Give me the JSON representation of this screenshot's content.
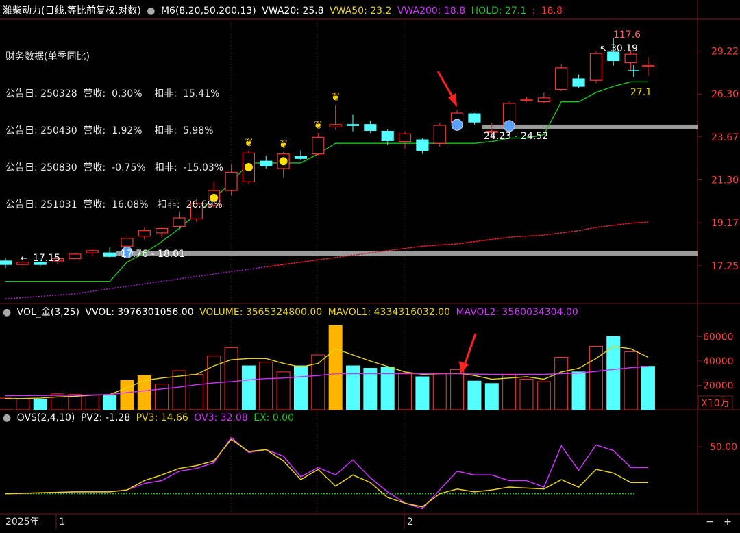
{
  "header": {
    "title": "潍柴动力(日线.等比前复权.对数)",
    "indicator": "M6(8,20,50,200,13)",
    "vwa20": "VWA20: 25.8",
    "vwa50": "VWA50: 23.2",
    "vwa200": "VWA200: 18.8",
    "hold_label": "HOLD: 27.1",
    "hold_colon": ":",
    "hold_value": "18.8"
  },
  "finance": {
    "title": "财务数据(单季同比)",
    "rows": [
      "公告日: 250328  营收:  0.30%    扣非:  15.41%",
      "公告日: 250430  营收:  1.92%    扣非:  5.98%",
      "公告日: 250830  营收:  -0.75%   扣非:  -15.03%",
      "公告日: 251031  营收:  16.08%   扣非:  26.69%"
    ]
  },
  "vol_header": {
    "name": "VOL_金(3,25)",
    "vvol": "VVOL: 3976301056.00",
    "volume": "VOLUME: 3565324800.00",
    "mavol1": "MAVOL1: 4334316032.00",
    "mavol2": "MAVOL2: 3560034304.00"
  },
  "ovs_header": {
    "name": "OVS(2,4,10)",
    "pv2": "PV2: -1.28",
    "pv3": "PV3: 14.66",
    "ov3": "OV3: 32.08",
    "ex": "EX: 0.00"
  },
  "time_axis": {
    "year": "2025年",
    "labels": [
      {
        "text": "1",
        "idx": 0
      },
      {
        "text": "2",
        "idx": 20
      }
    ]
  },
  "annotations": {
    "high": "117.6",
    "high_price": "30.19",
    "low_price": "17.15",
    "range_low": "17.76 - 18.01",
    "range_high": "24.23 - 24.52",
    "hold_price": "27.1",
    "vol_unit": "X10万"
  },
  "colors": {
    "up": "#ff3232",
    "down": "#54ffff",
    "vwa20": "#ffffff",
    "vwa50": "#e8d21d",
    "vwa200": "#d033ff",
    "hold": "#1ec31e",
    "ma200": "#e0203a",
    "grid": "#7a1b1b"
  },
  "chart_data": [
    {
      "type": "candlestick",
      "title": "潍柴动力(日线.等比前复权.对数)",
      "scale": "log",
      "yticks": [
        "29.22",
        "26.30",
        "23.67",
        "21.30",
        "19.17",
        "17.25"
      ],
      "ylim": [
        15.8,
        31.5
      ],
      "bars": [
        {
          "o": 17.45,
          "h": 17.6,
          "l": 17.15,
          "c": 17.3
        },
        {
          "o": 17.3,
          "h": 17.5,
          "l": 17.1,
          "c": 17.4
        },
        {
          "o": 17.4,
          "h": 17.55,
          "l": 17.2,
          "c": 17.3
        },
        {
          "o": 17.45,
          "h": 17.6,
          "l": 17.3,
          "c": 17.55
        },
        {
          "o": 17.55,
          "h": 17.8,
          "l": 17.45,
          "c": 17.75
        },
        {
          "o": 17.8,
          "h": 17.95,
          "l": 17.65,
          "c": 17.9
        },
        {
          "o": 17.8,
          "h": 18.05,
          "l": 17.6,
          "c": 17.65
        },
        {
          "o": 18.1,
          "h": 18.7,
          "l": 17.76,
          "c": 18.45
        },
        {
          "o": 18.55,
          "h": 18.95,
          "l": 18.4,
          "c": 18.8
        },
        {
          "o": 18.7,
          "h": 18.95,
          "l": 18.5,
          "c": 18.9
        },
        {
          "o": 19.0,
          "h": 19.7,
          "l": 18.9,
          "c": 19.4
        },
        {
          "o": 19.35,
          "h": 20.3,
          "l": 19.2,
          "c": 20.1
        },
        {
          "o": 20.0,
          "h": 21.2,
          "l": 19.9,
          "c": 20.75
        },
        {
          "o": 20.75,
          "h": 22.1,
          "l": 20.5,
          "c": 21.7
        },
        {
          "o": 21.2,
          "h": 22.9,
          "l": 21.1,
          "c": 22.75
        },
        {
          "o": 22.3,
          "h": 22.6,
          "l": 21.9,
          "c": 22.05
        },
        {
          "o": 21.9,
          "h": 22.8,
          "l": 21.4,
          "c": 22.7
        },
        {
          "o": 22.55,
          "h": 22.9,
          "l": 22.35,
          "c": 22.45
        },
        {
          "o": 22.7,
          "h": 23.9,
          "l": 22.6,
          "c": 23.65
        },
        {
          "o": 24.25,
          "h": 25.6,
          "l": 24.1,
          "c": 24.4
        },
        {
          "o": 24.4,
          "h": 25.0,
          "l": 24.0,
          "c": 24.35
        },
        {
          "o": 24.4,
          "h": 24.65,
          "l": 23.9,
          "c": 24.05
        },
        {
          "o": 24.0,
          "h": 24.1,
          "l": 23.2,
          "c": 23.45
        },
        {
          "o": 23.4,
          "h": 24.0,
          "l": 23.0,
          "c": 23.85
        },
        {
          "o": 23.5,
          "h": 23.6,
          "l": 22.7,
          "c": 22.9
        },
        {
          "o": 23.3,
          "h": 24.5,
          "l": 23.1,
          "c": 24.35
        },
        {
          "o": 24.5,
          "h": 25.3,
          "l": 24.3,
          "c": 25.1
        },
        {
          "o": 25.05,
          "h": 25.1,
          "l": 24.4,
          "c": 24.55
        },
        {
          "o": 24.0,
          "h": 24.5,
          "l": 23.6,
          "c": 24.0
        },
        {
          "o": 24.3,
          "h": 25.8,
          "l": 24.23,
          "c": 25.7
        },
        {
          "o": 25.9,
          "h": 26.1,
          "l": 25.8,
          "c": 25.95
        },
        {
          "o": 25.8,
          "h": 26.4,
          "l": 25.7,
          "c": 26.05
        },
        {
          "o": 26.6,
          "h": 28.3,
          "l": 26.5,
          "c": 28.05
        },
        {
          "o": 27.3,
          "h": 27.6,
          "l": 26.7,
          "c": 26.8
        },
        {
          "o": 27.2,
          "h": 29.2,
          "l": 27.0,
          "c": 29.05
        },
        {
          "o": 29.15,
          "h": 30.19,
          "l": 28.2,
          "c": 28.55
        },
        {
          "o": 28.4,
          "h": 29.3,
          "l": 27.8,
          "c": 29.0
        },
        {
          "o": 28.2,
          "h": 28.8,
          "l": 27.5,
          "c": 28.2
        }
      ],
      "hold": [
        16.6,
        16.6,
        16.6,
        16.6,
        16.6,
        16.6,
        16.6,
        17.4,
        17.8,
        18.3,
        18.9,
        19.6,
        20.35,
        21.15,
        22.2,
        22.2,
        22.2,
        22.2,
        22.7,
        23.3,
        23.3,
        23.3,
        23.3,
        23.3,
        23.3,
        23.3,
        23.3,
        23.3,
        23.4,
        23.6,
        23.6,
        23.8,
        25.8,
        25.8,
        26.4,
        26.8,
        27.1,
        27.1
      ],
      "ma200": [
        15.9,
        15.95,
        16.0,
        16.05,
        16.1,
        16.2,
        16.3,
        16.4,
        16.5,
        16.6,
        16.7,
        16.8,
        16.9,
        17.0,
        17.1,
        17.2,
        17.3,
        17.4,
        17.5,
        17.6,
        17.7,
        17.8,
        17.9,
        18.0,
        18.1,
        18.15,
        18.2,
        18.3,
        18.4,
        18.5,
        18.55,
        18.6,
        18.7,
        18.8,
        18.95,
        19.05,
        19.15,
        19.2
      ],
      "support_levels": [
        17.76,
        24.23
      ],
      "signals": {
        "butterfly": [
          14,
          16,
          18,
          19
        ],
        "yellow_dot": [
          12,
          14,
          16
        ],
        "blue_ball": [
          7,
          26,
          29
        ],
        "red_arrow": 26
      }
    },
    {
      "type": "bar",
      "title": "VOL_金(3,25)",
      "unit": "X10万",
      "yticks": [
        "60000",
        "40000",
        "20000"
      ],
      "ylim": [
        0,
        72000
      ],
      "values": [
        9500,
        9000,
        8500,
        13000,
        12500,
        12000,
        11500,
        24000,
        28000,
        21000,
        32000,
        29000,
        44000,
        51000,
        36000,
        39000,
        31000,
        36000,
        45000,
        69000,
        36000,
        34000,
        35000,
        30000,
        27000,
        30000,
        33000,
        23500,
        21500,
        28500,
        25000,
        23000,
        43000,
        31000,
        52000,
        60000,
        47500,
        35600
      ],
      "kind": [
        "up",
        "up",
        "down",
        "up",
        "up",
        "up",
        "down",
        "gold",
        "gold",
        "up",
        "up",
        "up",
        "up",
        "up",
        "down",
        "up",
        "up",
        "down",
        "up",
        "gold",
        "down",
        "down",
        "down",
        "up",
        "down",
        "up",
        "up",
        "down",
        "down",
        "up",
        "up",
        "up",
        "up",
        "down",
        "up",
        "down",
        "up",
        "down"
      ],
      "mavol1": [
        9000,
        9200,
        9500,
        10500,
        11000,
        12000,
        12500,
        18000,
        24000,
        26000,
        27500,
        29000,
        36000,
        41000,
        42000,
        42000,
        38000,
        35000,
        38000,
        50000,
        45000,
        40000,
        35500,
        31000,
        29000,
        29500,
        30000,
        28000,
        25000,
        26000,
        27000,
        25000,
        31000,
        34000,
        42000,
        52000,
        50000,
        43000
      ],
      "mavol2": [
        11500,
        11600,
        11700,
        11800,
        11900,
        12200,
        12500,
        14000,
        15500,
        17000,
        18500,
        20500,
        22000,
        23000,
        24500,
        25500,
        26000,
        27000,
        28000,
        29500,
        29500,
        29500,
        29500,
        29500,
        29500,
        29500,
        29500,
        29200,
        29000,
        29000,
        29000,
        29000,
        29500,
        30000,
        31500,
        33000,
        34500,
        35500
      ]
    },
    {
      "type": "line",
      "title": "OVS(2,4,10)",
      "yticks": [
        "50.00"
      ],
      "ylim": [
        -20,
        75
      ],
      "pv3": [
        0,
        0.5,
        1,
        1.5,
        2,
        2,
        2,
        4,
        14,
        20,
        27,
        30,
        35,
        58,
        45,
        47,
        35,
        15,
        26,
        8,
        20,
        12,
        -4,
        -10,
        -14,
        0,
        5,
        2,
        4,
        7,
        6,
        5,
        15,
        7,
        26,
        22,
        12,
        12
      ],
      "ov3": [
        0,
        0.5,
        1,
        1.5,
        2,
        2,
        2,
        4,
        11,
        14,
        24,
        27,
        33,
        60,
        44,
        47,
        40,
        18,
        28,
        20,
        36,
        17,
        2,
        -10,
        -16,
        4,
        24,
        20,
        20,
        14,
        14,
        7,
        51,
        25,
        52,
        46,
        28,
        28
      ],
      "ex": 0
    }
  ]
}
